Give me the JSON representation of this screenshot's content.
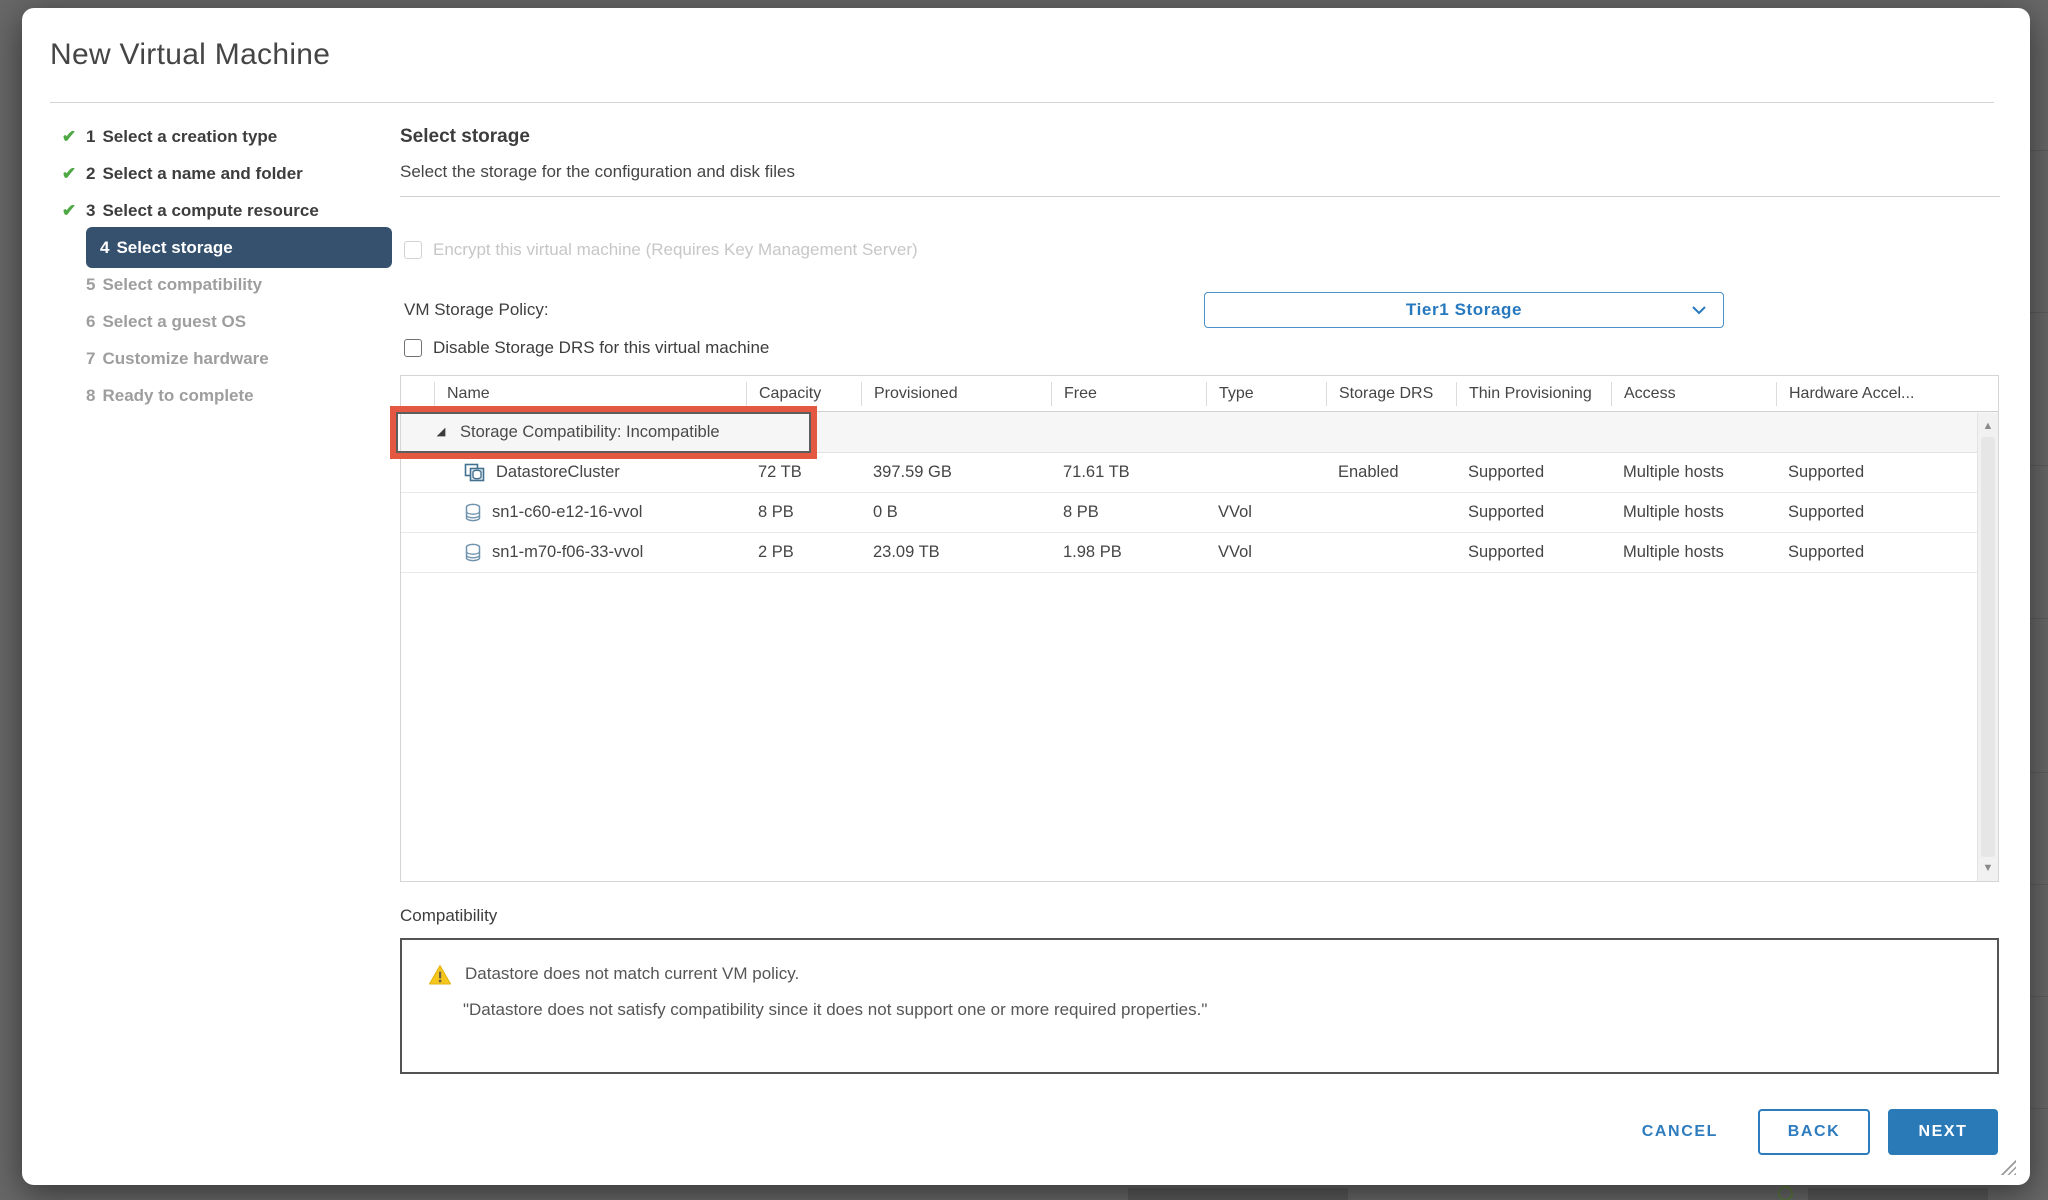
{
  "dialog": {
    "title": "New Virtual Machine",
    "steps": [
      {
        "num": "1",
        "label": "Select a creation type",
        "state": "done"
      },
      {
        "num": "2",
        "label": "Select a name and folder",
        "state": "done"
      },
      {
        "num": "3",
        "label": "Select a compute resource",
        "state": "done"
      },
      {
        "num": "4",
        "label": "Select storage",
        "state": "active"
      },
      {
        "num": "5",
        "label": "Select compatibility",
        "state": "todo"
      },
      {
        "num": "6",
        "label": "Select a guest OS",
        "state": "todo"
      },
      {
        "num": "7",
        "label": "Customize hardware",
        "state": "todo"
      },
      {
        "num": "8",
        "label": "Ready to complete",
        "state": "todo"
      }
    ],
    "content": {
      "heading": "Select storage",
      "subheading": "Select the storage for the configuration and disk files",
      "encrypt_checkbox_label": "Encrypt this virtual machine (Requires Key Management Server)",
      "vm_storage_policy_label": "VM Storage Policy:",
      "vm_storage_policy_value": "Tier1 Storage",
      "disable_drs_checkbox_label": "Disable Storage DRS for this virtual machine",
      "table": {
        "columns": [
          "Name",
          "Capacity",
          "Provisioned",
          "Free",
          "Type",
          "Storage DRS",
          "Thin Provisioning",
          "Access",
          "Hardware Accel..."
        ],
        "group_row_label": "Storage Compatibility: Incompatible",
        "rows": [
          {
            "name": "DatastoreCluster",
            "icon": "datastore-cluster",
            "capacity": "72 TB",
            "provisioned": "397.59 GB",
            "free": "71.61 TB",
            "type": "",
            "storage_drs": "Enabled",
            "thin_provisioning": "Supported",
            "access": "Multiple hosts",
            "hardware_accel": "Supported"
          },
          {
            "name": "sn1-c60-e12-16-vvol",
            "icon": "datastore",
            "capacity": "8 PB",
            "provisioned": "0 B",
            "free": "8 PB",
            "type": "VVol",
            "storage_drs": "",
            "thin_provisioning": "Supported",
            "access": "Multiple hosts",
            "hardware_accel": "Supported"
          },
          {
            "name": "sn1-m70-f06-33-vvol",
            "icon": "datastore",
            "capacity": "2 PB",
            "provisioned": "23.09 TB",
            "free": "1.98 PB",
            "type": "VVol",
            "storage_drs": "",
            "thin_provisioning": "Supported",
            "access": "Multiple hosts",
            "hardware_accel": "Supported"
          }
        ]
      },
      "compatibility": {
        "label": "Compatibility",
        "warning_title": "Datastore does not match current VM policy.",
        "warning_detail": "\"Datastore does not satisfy compatibility since it does not support one or more required properties.\""
      }
    },
    "footer": {
      "cancel_label": "CANCEL",
      "back_label": "BACK",
      "next_label": "NEXT"
    },
    "colors": {
      "accent_blue": "#2b7ab8",
      "active_step_bg": "#35516d",
      "check_green": "#4ea843",
      "annotation_red": "#e45741",
      "warning_yellow": "#f5c61c",
      "backdrop_dim": "#686868"
    }
  }
}
